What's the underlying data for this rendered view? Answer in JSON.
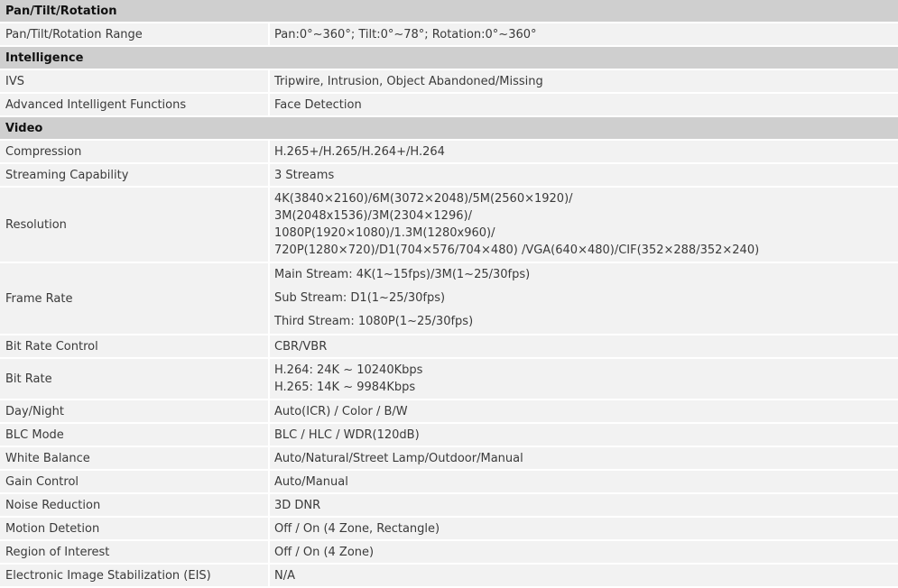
{
  "sections": [
    {
      "title": "Pan/Tilt/Rotation",
      "rows": [
        {
          "label": "Pan/Tilt/Rotation Range",
          "value": "Pan:0°~360°; Tilt:0°~78°; Rotation:0°~360°"
        }
      ]
    },
    {
      "title": "Intelligence",
      "rows": [
        {
          "label": "IVS",
          "value": "Tripwire, Intrusion, Object Abandoned/Missing"
        },
        {
          "label": "Advanced Intelligent Functions",
          "value": "Face Detection"
        }
      ]
    },
    {
      "title": "Video",
      "rows": [
        {
          "label": "Compression",
          "value": "H.265+/H.265/H.264+/H.264"
        },
        {
          "label": "Streaming Capability",
          "value": "3 Streams"
        },
        {
          "label": "Resolution",
          "lines": [
            "4K(3840×2160)/6M(3072×2048)/5M(2560×1920)/",
            "3M(2048x1536)/3M(2304×1296)/",
            "1080P(1920×1080)/1.3M(1280x960)/",
            "720P(1280×720)/D1(704×576/704×480) /VGA(640×480)/CIF(352×288/352×240)"
          ]
        },
        {
          "label": "Frame Rate",
          "lines": [
            "Main Stream: 4K(1~15fps)/3M(1~25/30fps)",
            "Sub Stream: D1(1~25/30fps)",
            "Third Stream: 1080P(1~25/30fps)"
          ]
        },
        {
          "label": "Bit Rate Control",
          "value": "CBR/VBR"
        },
        {
          "label": "Bit Rate",
          "lines": [
            "H.264: 24K ~ 10240Kbps",
            "H.265: 14K ~ 9984Kbps"
          ]
        },
        {
          "label": "Day/Night",
          "value": "Auto(ICR) / Color / B/W"
        },
        {
          "label": "BLC Mode",
          "value": "BLC / HLC / WDR(120dB)"
        },
        {
          "label": "White Balance",
          "value": "Auto/Natural/Street Lamp/Outdoor/Manual"
        },
        {
          "label": "Gain Control",
          "value": "Auto/Manual"
        },
        {
          "label": "Noise Reduction",
          "value": "3D DNR"
        },
        {
          "label": "Motion Detetion",
          "value": "Off / On (4 Zone, Rectangle)"
        },
        {
          "label": "Region of Interest",
          "value": "Off / On (4 Zone)"
        },
        {
          "label": "Electronic Image Stabilization (EIS)",
          "value": "N/A"
        }
      ]
    }
  ]
}
